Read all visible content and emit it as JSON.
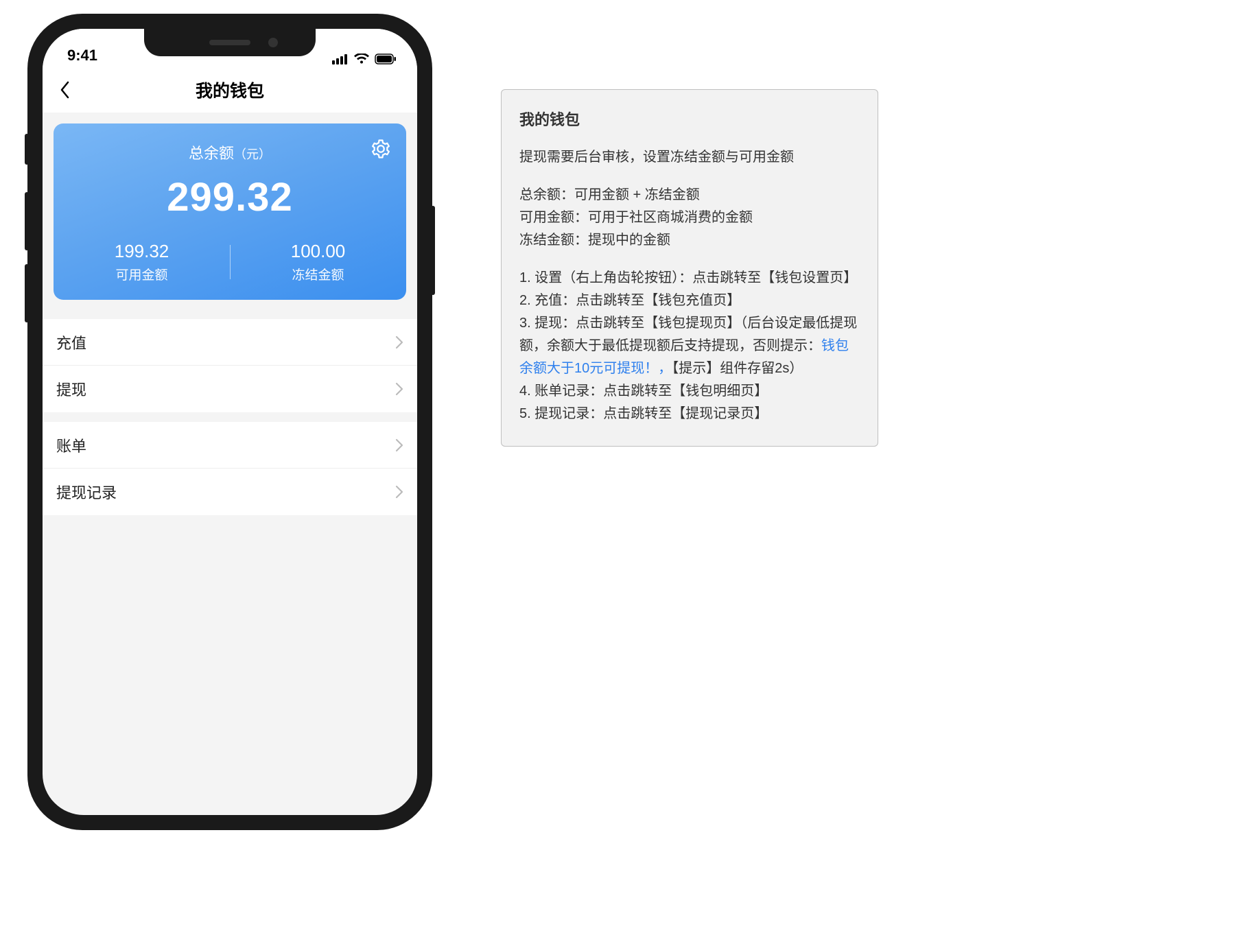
{
  "status": {
    "time": "9:41"
  },
  "nav": {
    "title": "我的钱包"
  },
  "balance": {
    "title": "总余额",
    "unit": "（元）",
    "amount": "299.32",
    "available_value": "199.32",
    "available_label": "可用金额",
    "frozen_value": "100.00",
    "frozen_label": "冻结金额"
  },
  "menu": {
    "recharge": "充值",
    "withdraw": "提现",
    "bill": "账单",
    "withdraw_log": "提现记录"
  },
  "spec": {
    "title": "我的钱包",
    "intro": "提现需要后台审核，设置冻结金额与可用金额",
    "def1": "总余额：可用金额 + 冻结金额",
    "def2": "可用金额：可用于社区商城消费的金额",
    "def3": "冻结金额：提现中的金额",
    "n1a": "1. 设置（右上角齿轮按钮）：点击跳转至【钱包设置页】",
    "n2": "2. 充值：点击跳转至【钱包充值页】",
    "n3a": "3. 提现：点击跳转至【钱包提现页】（后台设定最低提现额，余额大于最低提现额后支持提现，否则提示：",
    "n3hl": "钱包余额大于10元可提现！，",
    "n3b": "【提示】组件存留2s）",
    "n4": "4. 账单记录：点击跳转至【钱包明细页】",
    "n5": "5. 提现记录：点击跳转至【提现记录页】"
  }
}
